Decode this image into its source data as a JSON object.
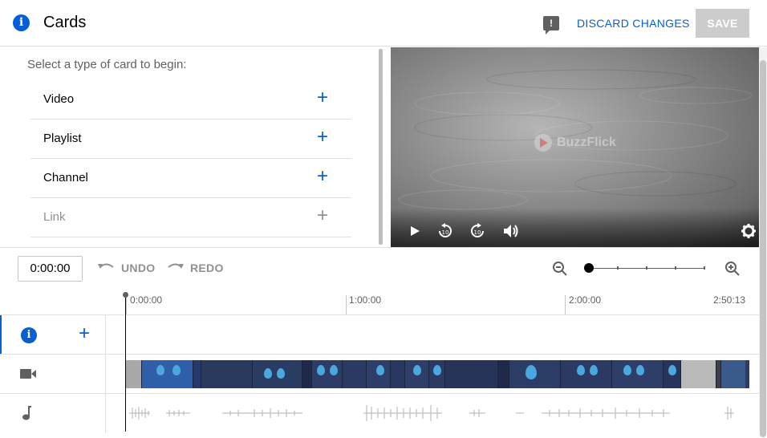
{
  "header": {
    "title": "Cards",
    "discard_label": "DISCARD CHANGES",
    "save_label": "SAVE",
    "info_glyph": "i",
    "feedback_glyph": "!"
  },
  "cards_panel": {
    "prompt": "Select a type of card to begin:",
    "items": [
      {
        "label": "Video",
        "enabled": true
      },
      {
        "label": "Playlist",
        "enabled": true
      },
      {
        "label": "Channel",
        "enabled": true
      },
      {
        "label": "Link",
        "enabled": false
      }
    ]
  },
  "video": {
    "watermark": "BuzzFlick"
  },
  "timeline": {
    "current_time": "0:00:00",
    "undo_label": "UNDO",
    "redo_label": "REDO",
    "ruler": [
      "0:00:00",
      "1:00:00",
      "2:00:00",
      "2:50:13"
    ],
    "track_info_glyph": "i",
    "track_add_glyph": "+"
  },
  "colors": {
    "accent": "#065fd4",
    "disabled": "#909090",
    "save_disabled_bg": "#cccccc"
  }
}
